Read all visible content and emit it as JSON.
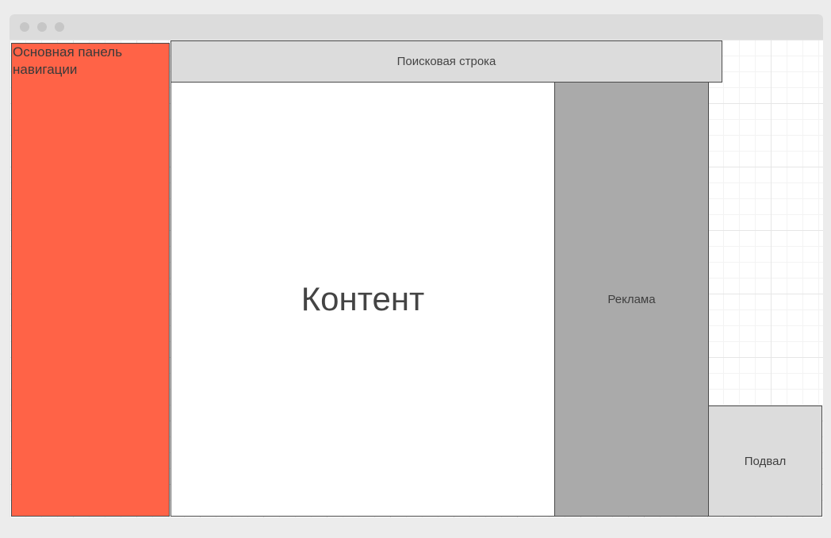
{
  "diagram": {
    "nav_panel": {
      "label": "Основная панель навигации",
      "color": "#ff6347"
    },
    "search_bar": {
      "label": "Поисковая строка",
      "color": "#dcdcdc"
    },
    "content": {
      "label": "Контент",
      "color": "#ffffff"
    },
    "ads": {
      "label": "Реклама",
      "color": "#aaaaaa"
    },
    "footer": {
      "label": "Подвал",
      "color": "#dcdcdc"
    }
  }
}
